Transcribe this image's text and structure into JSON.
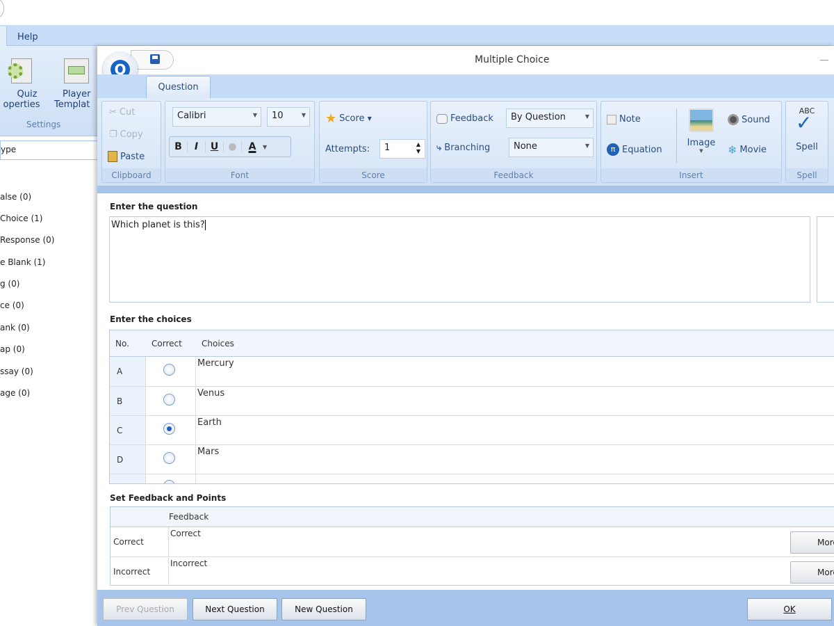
{
  "background_app": {
    "menu": {
      "help": "Help"
    },
    "ribbon": {
      "quiz_properties": [
        "Quiz",
        "operties"
      ],
      "player_template": [
        "Player",
        "Templat"
      ],
      "group_settings": "Settings"
    },
    "search_value": "ype",
    "question_types": [
      "alse  (0)",
      " Choice  (1)",
      " Response  (0)",
      "e Blank  (1)",
      "g  (0)",
      "ce  (0)",
      "ank  (0)",
      "ap  (0)",
      "ssay  (0)",
      "age  (0)"
    ]
  },
  "dialog": {
    "title": "Multiple Choice",
    "tab": "Question",
    "ribbon": {
      "clipboard": {
        "cut": "Cut",
        "copy": "Copy",
        "paste": "Paste",
        "label": "Clipboard"
      },
      "font": {
        "family": "Calibri",
        "size": "10",
        "bold": "B",
        "italic": "I",
        "underline": "U",
        "color": "A",
        "label": "Font"
      },
      "score": {
        "score": "Score",
        "attempts_label": "Attempts:",
        "attempts_value": "1",
        "label": "Score"
      },
      "feedback": {
        "feedback": "Feedback",
        "feedback_value": "By Question",
        "branching": "Branching",
        "branching_value": "None",
        "label": "Feedback"
      },
      "insert": {
        "note": "Note",
        "equation": "Equation",
        "image": "Image",
        "sound": "Sound",
        "movie": "Movie",
        "label": "Insert"
      },
      "spell": {
        "button": "Spell",
        "abc": "ABC",
        "label": "Spell"
      }
    },
    "question_label": "Enter the question",
    "question_text": "Which planet is this?",
    "choices_label": "Enter the choices",
    "choices_headers": {
      "no": "No.",
      "correct": "Correct",
      "choices": "Choices"
    },
    "choices": [
      {
        "no": "A",
        "text": "Mercury",
        "correct": false
      },
      {
        "no": "B",
        "text": "Venus",
        "correct": false
      },
      {
        "no": "C",
        "text": "Earth",
        "correct": true
      },
      {
        "no": "D",
        "text": "Mars",
        "correct": false
      }
    ],
    "feedback_label": "Set Feedback and Points",
    "feedback_header": "Feedback",
    "feedback_rows": [
      {
        "label": "Correct",
        "text": "Correct",
        "more": "More..."
      },
      {
        "label": "Incorrect",
        "text": "Incorrect",
        "more": "More..."
      }
    ],
    "buttons": {
      "prev": "Prev Question",
      "next": "Next Question",
      "new": "New Question",
      "ok": "OK"
    }
  }
}
